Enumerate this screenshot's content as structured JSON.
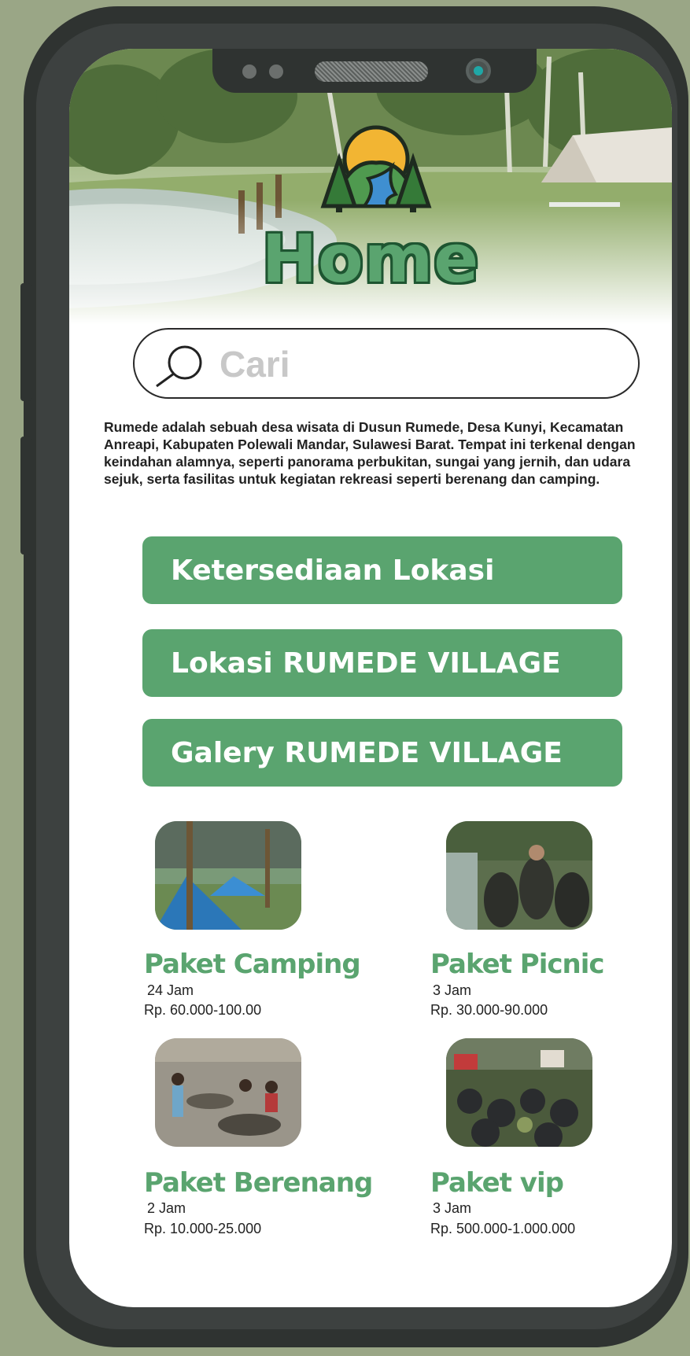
{
  "page": {
    "title": "Home"
  },
  "search": {
    "placeholder": "Cari"
  },
  "description": "Rumede adalah sebuah desa wisata di Dusun Rumede, Desa Kunyi, Kecamatan Anreapi, Kabupaten Polewali Mandar, Sulawesi Barat. Tempat ini terkenal dengan keindahan alamnya, seperti panorama perbukitan, sungai yang jernih, dan udara sejuk, serta fasilitas untuk kegiatan rekreasi seperti berenang dan camping.",
  "nav": [
    {
      "label": "Ketersediaan Lokasi"
    },
    {
      "label": "Lokasi RUMEDE VILLAGE"
    },
    {
      "label": "Galery RUMEDE VILLAGE"
    }
  ],
  "packages": [
    {
      "name": "Paket Camping",
      "duration": "24 Jam",
      "price": "Rp. 60.000-100.00"
    },
    {
      "name": "Paket Picnic",
      "duration": "3 Jam",
      "price": "Rp. 30.000-90.000"
    },
    {
      "name": "Paket Berenang",
      "duration": "2 Jam",
      "price": "Rp. 10.000-25.000"
    },
    {
      "name": "Paket vip",
      "duration": "3 Jam",
      "price": "Rp. 500.000-1.000.000"
    }
  ],
  "colors": {
    "background": "#9aa686",
    "phone_frame": "#2f3331",
    "accent_green": "#5aa46f",
    "title_outline": "#1e5531",
    "search_placeholder": "#c8c8c8"
  },
  "icons": {
    "search": "magnifier-icon",
    "logo": "mountain-river-logo-icon",
    "camera": "front-camera-icon"
  }
}
